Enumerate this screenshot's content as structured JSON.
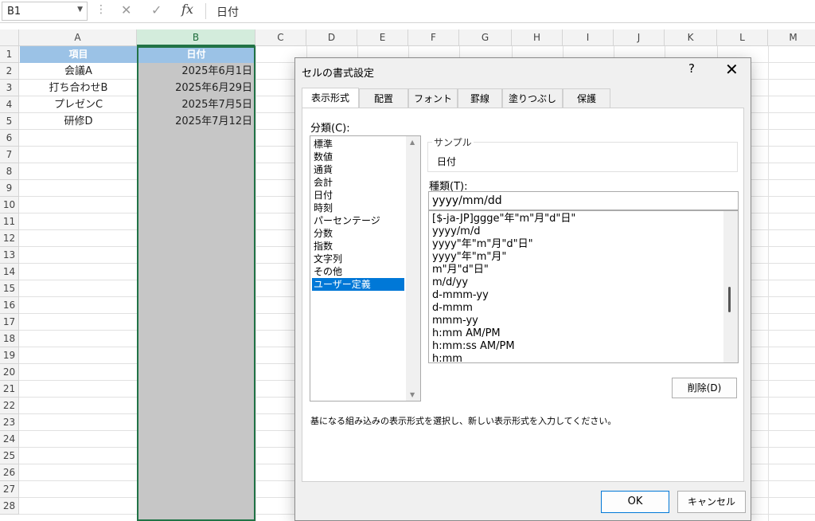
{
  "formula_bar": {
    "name_box": "B1",
    "name_box_arrow": "▼",
    "dots": "⋮",
    "cancel_symbol": "✕",
    "enter_symbol": "✓",
    "fx_symbol": "fx",
    "content": "日付"
  },
  "sheet": {
    "columns": [
      "A",
      "B",
      "C",
      "D",
      "E",
      "F",
      "G",
      "H",
      "I",
      "J",
      "K",
      "L",
      "M"
    ],
    "selected_column": "B",
    "rows": [
      "1",
      "2",
      "3",
      "4",
      "5",
      "6",
      "7",
      "8",
      "9",
      "10",
      "11",
      "12",
      "13",
      "14",
      "15",
      "16",
      "17",
      "18",
      "19",
      "20",
      "21",
      "22",
      "23",
      "24",
      "25",
      "26",
      "27",
      "28"
    ],
    "header_fill": "#9bc2e6",
    "selected_fill": "#c6c6c6",
    "selection_border": "#217346",
    "cells": {
      "A1": "項目",
      "B1": "日付",
      "A2": "会議A",
      "B2": "2025年6月1日",
      "A3": "打ち合わせB",
      "B3": "2025年6月29日",
      "A4": "プレゼンC",
      "B4": "2025年7月5日",
      "A5": "研修D",
      "B5": "2025年7月12日"
    }
  },
  "dialog": {
    "title": "セルの書式設定",
    "help_symbol": "?",
    "close_symbol": "✕",
    "tabs": [
      "表示形式",
      "配置",
      "フォント",
      "罫線",
      "塗りつぶし",
      "保護"
    ],
    "active_tab": "表示形式",
    "category_label": "分類(C):",
    "categories": [
      "標準",
      "数値",
      "通貨",
      "会計",
      "日付",
      "時刻",
      "パーセンテージ",
      "分数",
      "指数",
      "文字列",
      "その他",
      "ユーザー定義"
    ],
    "selected_category": "ユーザー定義",
    "scroll_up_symbol": "▲",
    "scroll_down_symbol": "▼",
    "sample_label": "サンプル",
    "sample_value": "日付",
    "type_label": "種類(T):",
    "type_value": "yyyy/mm/dd",
    "format_list": [
      "[$-ja-JP]ggge\"年\"m\"月\"d\"日\"",
      "yyyy/m/d",
      "yyyy\"年\"m\"月\"d\"日\"",
      "yyyy\"年\"m\"月\"",
      "m\"月\"d\"日\"",
      "m/d/yy",
      "d-mmm-yy",
      "d-mmm",
      "mmm-yy",
      "h:mm AM/PM",
      "h:mm:ss AM/PM",
      "h:mm"
    ],
    "delete_button": "削除(D)",
    "description": "基になる組み込みの表示形式を選択し、新しい表示形式を入力してください。",
    "ok_button": "OK",
    "cancel_button": "キャンセル",
    "selection_color": "#0078d7"
  }
}
